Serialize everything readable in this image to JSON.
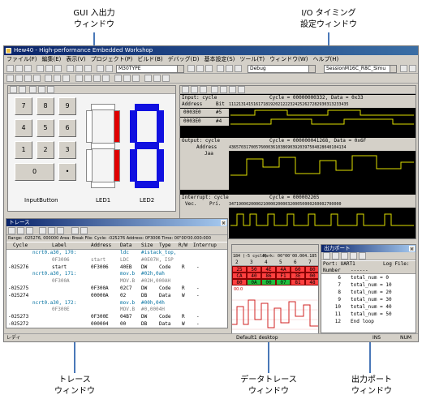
{
  "callouts": {
    "gui_io": [
      "GUI 入出力",
      "ウィンドウ"
    ],
    "io_timing": [
      "I/O タイミング",
      "設定ウィンドウ"
    ],
    "trace": [
      "トレース",
      "ウィンドウ"
    ],
    "data_trace": [
      "データトレース",
      "ウィンドウ"
    ],
    "output_port": [
      "出力ポート",
      "ウィンドウ"
    ]
  },
  "app": {
    "title": "Hew40 - High-performance Embedded Workshop",
    "menu": [
      "ファイル(F)",
      "編集(E)",
      "表示(V)",
      "プロジェクト(P)",
      "ビルド(B)",
      "デバッグ(D)",
      "基本設定(S)",
      "ツール(T)",
      "ウィンドウ(W)",
      "ヘルプ(H)"
    ],
    "combo_target": "M30TYPE",
    "combo_config": "Debug",
    "combo_session": "SessionM16C_R8C_Simu",
    "status_left": "レディ",
    "status_desktop": "Default1 desktop",
    "status_ins": "INS",
    "status_num": "NUM"
  },
  "gui": {
    "keys": [
      "7",
      "8",
      "9",
      "4",
      "5",
      "6",
      "1",
      "2",
      "3",
      "0",
      "•"
    ],
    "input_label": "InputButton",
    "led1_label": "LED1",
    "led2_label": "LED2",
    "colors": {
      "led_red": "#e00000",
      "led_blue": "#1010e0"
    }
  },
  "io": {
    "input_header": "Input: cycle",
    "input_cycle": "Cycle = 00000000332, Data = 0x33",
    "input_cols": [
      "Address",
      "Bit"
    ],
    "input_bits": "1112131415161718192021222324252627282930313233435",
    "input_rows": [
      {
        "addr": "0003E0",
        "bit": "#5"
      },
      {
        "addr": "0003E0",
        "bit": "#4"
      }
    ],
    "output_header": "Output: cycle",
    "output_cycle": "Cycle = 000000041268, Data = 0x6F",
    "output_cols": [
      "Address",
      "Jaa"
    ],
    "output_data": "436570317005760003610386903920397504028040104134",
    "interrupt_header": "Interrupt: cycle",
    "interrupt_cycle": "Cycle = 000002265",
    "interrupt_cols": [
      "Vec.",
      "Pri."
    ],
    "interrupt_data": "3471900020000210000200003200050000260002700000"
  },
  "trace": {
    "title": "トレース",
    "info": "Range: -025276, 000000  Area: Break  File:  Cycle: -025276  Address: 0F3006  Time: 00\"00'00.000:000",
    "cols": [
      "Cycle",
      "Label",
      "Address",
      "Data",
      "Size",
      "Type",
      "R/W",
      "Interrup"
    ],
    "rows": [
      {
        "cycle": "",
        "label": "ncrt0.a30, 170:",
        "addr": "",
        "data": "ldc",
        "size": "#istack_top,",
        "type": "",
        "rw": "",
        "int": "",
        "src": true
      },
      {
        "cycle": "",
        "label": "0F3006",
        "addr": "start",
        "data": "LDC",
        "size": "#0E07H, ISP",
        "type": "",
        "rw": "",
        "int": "",
        "src": false,
        "dim": true
      },
      {
        "cycle": "-025276",
        "label": "start",
        "addr": "0F3006",
        "data": "40EB",
        "size": "DW",
        "type": "Code",
        "rw": "R",
        "int": "-",
        "src": false
      },
      {
        "cycle": "",
        "label": "ncrt0.a30, 171:",
        "addr": "",
        "data": "mov.b",
        "size": "#02h,0ah",
        "type": "",
        "rw": "",
        "int": "",
        "src": true
      },
      {
        "cycle": "",
        "label": "0F300A",
        "addr": "",
        "data": "MOV.B",
        "size": "#02H,000AH",
        "type": "",
        "rw": "",
        "int": "",
        "src": false,
        "dim": true
      },
      {
        "cycle": "-025275",
        "label": "",
        "addr": "0F300A",
        "data": "02C7",
        "size": "DW",
        "type": "Code",
        "rw": "R",
        "int": "-",
        "src": false
      },
      {
        "cycle": "-025274",
        "label": "",
        "addr": "00000A",
        "data": "02",
        "size": "DB",
        "type": "Data",
        "rw": "W",
        "int": "-",
        "src": false
      },
      {
        "cycle": "",
        "label": "ncrt0.a30, 172:",
        "addr": "",
        "data": "mov.b",
        "size": "#00h,04h",
        "type": "",
        "rw": "",
        "int": "",
        "src": true
      },
      {
        "cycle": "",
        "label": "0F300E",
        "addr": "",
        "data": "MOV.B",
        "size": "#0,0004H",
        "type": "",
        "rw": "",
        "int": "",
        "src": false,
        "dim": true
      },
      {
        "cycle": "-025273",
        "label": "",
        "addr": "0F300E",
        "data": "04B7",
        "size": "DW",
        "type": "Code",
        "rw": "R",
        "int": "-",
        "src": false
      },
      {
        "cycle": "-025272",
        "label": "",
        "addr": "000004",
        "data": "00",
        "size": "DB",
        "type": "Data",
        "rw": "W",
        "int": "-",
        "src": false
      }
    ]
  },
  "data_trace": {
    "header_a": "184 (-5 cycle)",
    "header_b": "Mark: 00\"00'00.004.185 - 00\"(",
    "cols": [
      "2",
      "3",
      "4",
      "5",
      "6",
      "7"
    ],
    "rows": [
      [
        "25",
        "50",
        "4E",
        "4A",
        "60",
        "80"
      ],
      [
        "CA",
        "40",
        "86",
        "F1",
        "3E",
        "00"
      ],
      [
        "80",
        "0A",
        "00",
        "07",
        "81",
        "48"
      ]
    ],
    "scale_label": "00.0"
  },
  "outport": {
    "title": "出力ポート",
    "port_label": "Port: UART1",
    "log_label": "Log File:",
    "cols": [
      "Number",
      "------"
    ],
    "rows": [
      {
        "n": "6",
        "text": "total_num = 0"
      },
      {
        "n": "7",
        "text": "total_num = 10"
      },
      {
        "n": "8",
        "text": "total_num = 20"
      },
      {
        "n": "9",
        "text": "total_num = 30"
      },
      {
        "n": "10",
        "text": "total_num = 40"
      },
      {
        "n": "11",
        "text": "total_num = 50"
      },
      {
        "n": "12",
        "text": "End loop"
      }
    ]
  }
}
